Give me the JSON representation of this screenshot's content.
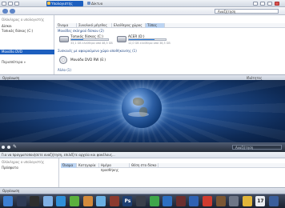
{
  "top_window": {
    "tabs": [
      {
        "label": "Υπολογιστής",
        "active": true
      },
      {
        "label": "Δίκτυο",
        "active": false
      }
    ],
    "search_placeholder": "Αναζήτηση",
    "sidebar": [
      {
        "label": "Ολόκληρος ο υπολογιστής",
        "muted": true
      },
      {
        "label": "Δίσκοι",
        "muted": false
      },
      {
        "label": "Τοπικός δίσκος (C:)",
        "muted": false
      },
      {
        "label": "Μονάδα DVD",
        "selected": true
      },
      {
        "label": "Περισσότερα »",
        "muted": false
      }
    ],
    "columns": [
      {
        "label": "Όνομα",
        "selected": false
      },
      {
        "label": "Συνολικό μέγεθος",
        "selected": false
      },
      {
        "label": "Ελεύθερος χώρος",
        "selected": false
      },
      {
        "label": "Τύπος",
        "selected": true
      }
    ],
    "group_drives": "Μονάδες σκληρού δίσκου (2)",
    "drives": [
      {
        "name": "Τοπικός δίσκος (C:)",
        "free": "33,1 GB ελεύθερα από 48,5 GB",
        "used_fraction": 0.32
      },
      {
        "name": "ACER (D:)",
        "free": "12,0 GB ελεύθερα από 38,5 GB",
        "used_fraction": 0.69
      }
    ],
    "group_removable": "Συσκευές με αφαιρούμενο χώρο αποθήκευσης (1)",
    "dvd": {
      "name": "Μονάδα DVD RW (E:)"
    },
    "other_label": "Άλλο (1)",
    "status_left": "Οργάνωση",
    "status_right": "Ιδιότητες"
  },
  "bottom_window": {
    "search_placeholder": "Αναζήτηση",
    "notice": "Για να πραγματοποιήσετε αναζήτηση, επιλέξτε αρχεία και φακέλους...",
    "sidebar": [
      {
        "label": "Ολόκληρος ο υπολογιστής",
        "muted": true
      },
      {
        "label": "Πρόσφατα",
        "muted": false
      }
    ],
    "columns": [
      {
        "label": "Όνομα",
        "selected": true
      },
      {
        "label": "Κατηγορία",
        "selected": false
      },
      {
        "label": "Ημέρα προσθήκης",
        "selected": false
      },
      {
        "label": "Θέση στο δίσκο",
        "selected": false
      }
    ],
    "status_left": "Οργάνωση"
  },
  "dock": {
    "icons": [
      {
        "name": "finder-icon",
        "color": "#3d7fd1",
        "glyph": ""
      },
      {
        "name": "dashboard-icon",
        "color": "#2f3b55",
        "glyph": ""
      },
      {
        "name": "terminal-icon",
        "color": "#2e2e2e",
        "glyph": ""
      },
      {
        "name": "mail-icon",
        "color": "#7fb0e5",
        "glyph": ""
      },
      {
        "name": "safari-icon",
        "color": "#2e8fd8",
        "glyph": ""
      },
      {
        "name": "ichat-icon",
        "color": "#5ab03e",
        "glyph": ""
      },
      {
        "name": "photos-icon",
        "color": "#d38a3c",
        "glyph": ""
      },
      {
        "name": "itunes-icon",
        "color": "#6ab0e3",
        "glyph": ""
      },
      {
        "name": "frontrow-icon",
        "color": "#8b3a2f",
        "glyph": ""
      },
      {
        "name": "photoshop-icon",
        "color": "#1f3f72",
        "glyph": "Ps"
      },
      {
        "name": "video-icon",
        "color": "#3a3f4a",
        "glyph": ""
      },
      {
        "name": "xbox-icon",
        "color": "#3ea64a",
        "glyph": ""
      },
      {
        "name": "itunes-music-icon",
        "color": "#2d6fc1",
        "glyph": ""
      },
      {
        "name": "photo-booth-icon",
        "color": "#6b2e2e",
        "glyph": ""
      },
      {
        "name": "windows-icon",
        "color": "#2f62b3",
        "glyph": ""
      },
      {
        "name": "chrome-icon",
        "color": "#cf3b2f",
        "glyph": ""
      },
      {
        "name": "app-icon",
        "color": "#7a5634",
        "glyph": ""
      },
      {
        "name": "settings-icon",
        "color": "#6e7687",
        "glyph": ""
      },
      {
        "name": "notes-icon",
        "color": "#e1b53a",
        "glyph": ""
      },
      {
        "name": "calendar-icon",
        "color": "#e9ecf1",
        "glyph": "17"
      },
      {
        "name": "trash-icon",
        "color": "#3a5e9b",
        "glyph": ""
      }
    ]
  }
}
